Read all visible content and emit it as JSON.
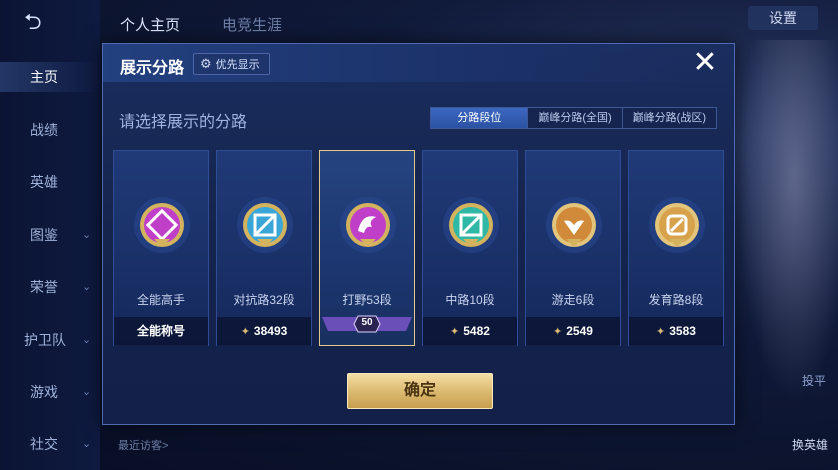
{
  "background": {
    "back_icon": "back-arrow-icon",
    "top_tabs": [
      "个人主页",
      "电竞生涯"
    ],
    "settings_label": "设置",
    "sidebar": [
      {
        "label": "主页",
        "active": true
      },
      {
        "label": "战绩"
      },
      {
        "label": "英雄"
      },
      {
        "label": "图鉴"
      },
      {
        "label": "荣誉"
      },
      {
        "label": "护卫队"
      },
      {
        "label": "游戏"
      },
      {
        "label": "社交"
      }
    ],
    "recent_visit": "最近访客>",
    "switch_hero_label": "换英雄",
    "peek_label": "投平"
  },
  "dialog": {
    "title": "展示分路",
    "priority_button": "优先显示",
    "close_icon": "close-icon",
    "subtitle": "请选择展示的分路",
    "segments": [
      {
        "label": "分路段位",
        "active": true
      },
      {
        "label": "巅峰分路(全国)"
      },
      {
        "label": "巅峰分路(战区)"
      }
    ],
    "cards": [
      {
        "name": "全能高手",
        "stat": "全能称号",
        "emblem_color": "#c03fc8",
        "show_diamond": false
      },
      {
        "name": "对抗路32段",
        "stat": "38493",
        "emblem_color": "#3aa6d8",
        "show_diamond": true
      },
      {
        "name": "打野53段",
        "stat": "",
        "emblem_color": "#c03fc8",
        "show_diamond": false,
        "selected": true,
        "level_badge": "50"
      },
      {
        "name": "中路10段",
        "stat": "5482",
        "emblem_color": "#2fb8a5",
        "show_diamond": true
      },
      {
        "name": "游走6段",
        "stat": "2549",
        "emblem_color": "#d08a3a",
        "show_diamond": true
      },
      {
        "name": "发育路8段",
        "stat": "3583",
        "emblem_color": "#d8a24c",
        "show_diamond": true
      }
    ],
    "confirm_button": "确定"
  },
  "colors": {
    "accent_gold": "#e3c98a",
    "panel_blue": "#1a2d5e",
    "active_tab": "#3c67c0"
  }
}
